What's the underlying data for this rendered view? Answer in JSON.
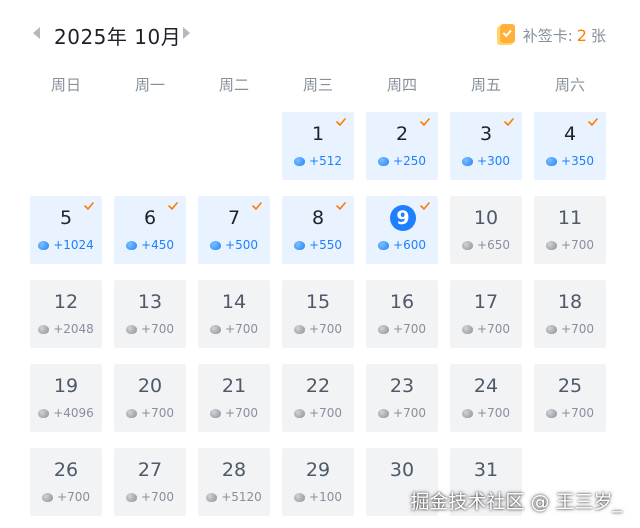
{
  "header": {
    "month_title": "2025年 10月",
    "makeup_label": "补签卡:",
    "makeup_count": "2",
    "makeup_unit": "张"
  },
  "weekdays": [
    "周日",
    "周一",
    "周二",
    "周三",
    "周四",
    "周五",
    "周六"
  ],
  "days": [
    {
      "day": "1",
      "reward": "+512",
      "status": "signed"
    },
    {
      "day": "2",
      "reward": "+250",
      "status": "signed"
    },
    {
      "day": "3",
      "reward": "+300",
      "status": "signed"
    },
    {
      "day": "4",
      "reward": "+350",
      "status": "signed"
    },
    {
      "day": "5",
      "reward": "+1024",
      "status": "signed"
    },
    {
      "day": "6",
      "reward": "+450",
      "status": "signed"
    },
    {
      "day": "7",
      "reward": "+500",
      "status": "signed"
    },
    {
      "day": "8",
      "reward": "+550",
      "status": "signed"
    },
    {
      "day": "9",
      "reward": "+600",
      "status": "today"
    },
    {
      "day": "10",
      "reward": "+650",
      "status": "future"
    },
    {
      "day": "11",
      "reward": "+700",
      "status": "future"
    },
    {
      "day": "12",
      "reward": "+2048",
      "status": "future"
    },
    {
      "day": "13",
      "reward": "+700",
      "status": "future"
    },
    {
      "day": "14",
      "reward": "+700",
      "status": "future"
    },
    {
      "day": "15",
      "reward": "+700",
      "status": "future"
    },
    {
      "day": "16",
      "reward": "+700",
      "status": "future"
    },
    {
      "day": "17",
      "reward": "+700",
      "status": "future"
    },
    {
      "day": "18",
      "reward": "+700",
      "status": "future"
    },
    {
      "day": "19",
      "reward": "+4096",
      "status": "future"
    },
    {
      "day": "20",
      "reward": "+700",
      "status": "future"
    },
    {
      "day": "21",
      "reward": "+700",
      "status": "future"
    },
    {
      "day": "22",
      "reward": "+700",
      "status": "future"
    },
    {
      "day": "23",
      "reward": "+700",
      "status": "future"
    },
    {
      "day": "24",
      "reward": "+700",
      "status": "future"
    },
    {
      "day": "25",
      "reward": "+700",
      "status": "future"
    },
    {
      "day": "26",
      "reward": "+700",
      "status": "future"
    },
    {
      "day": "27",
      "reward": "+700",
      "status": "future"
    },
    {
      "day": "28",
      "reward": "+5120",
      "status": "future"
    },
    {
      "day": "29",
      "reward": "+100",
      "status": "future"
    },
    {
      "day": "30",
      "reward": "",
      "status": "future"
    },
    {
      "day": "31",
      "reward": "",
      "status": "future"
    }
  ],
  "icons": {
    "ore": "ore-icon",
    "check": "check-icon",
    "makeup_card": "makeup-card-icon"
  },
  "colors": {
    "accent": "#1e80ff",
    "signed_bg": "#e8f3ff",
    "future_bg": "#f2f3f5",
    "check": "#ff7d00",
    "card_count": "#ff7d00"
  },
  "watermark": "掘金技术社区 @ 王三岁_"
}
